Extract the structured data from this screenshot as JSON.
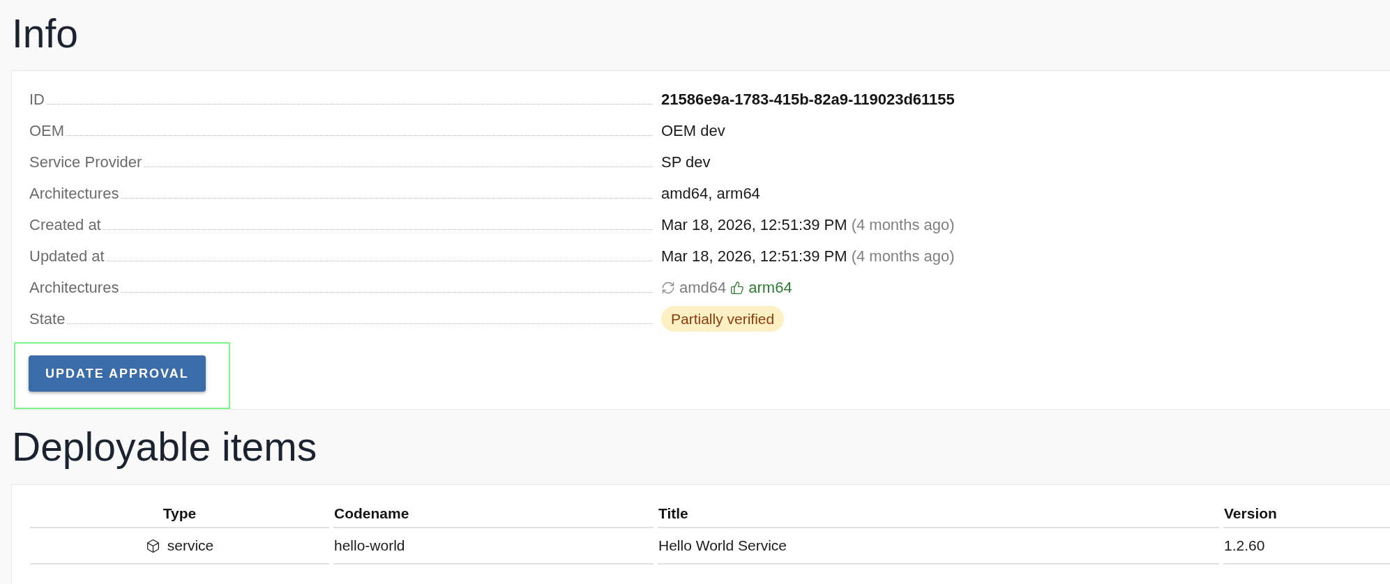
{
  "info": {
    "title": "Info",
    "fields": [
      {
        "label": "ID",
        "kind": "strong",
        "value": "21586e9a-1783-415b-82a9-119023d61155"
      },
      {
        "label": "OEM",
        "kind": "text",
        "value": "OEM dev"
      },
      {
        "label": "Service Provider",
        "kind": "text",
        "value": "SP dev"
      },
      {
        "label": "Architectures",
        "kind": "text",
        "value": "amd64, arm64"
      },
      {
        "label": "Created at",
        "kind": "date",
        "value": "Mar 18, 2026, 12:51:39 PM",
        "relative": "(4 months ago)"
      },
      {
        "label": "Updated at",
        "kind": "date",
        "value": "Mar 18, 2026, 12:51:39 PM",
        "relative": "(4 months ago)"
      },
      {
        "label": "Architectures",
        "kind": "architectures",
        "items": [
          {
            "name": "amd64",
            "kind": "syncing"
          },
          {
            "name": "arm64",
            "kind": "approved"
          }
        ]
      },
      {
        "label": "State",
        "kind": "badge",
        "value": "Partially verified"
      }
    ],
    "button": {
      "label": "UPDATE APPROVAL",
      "highlighted": true
    }
  },
  "deployable_items": {
    "title": "Deployable items",
    "columns": [
      "Type",
      "Codename",
      "Title",
      "Version"
    ],
    "rows": [
      {
        "cells": [
          "service",
          "hello-world",
          "Hello World Service",
          "1.2.60"
        ]
      }
    ]
  }
}
